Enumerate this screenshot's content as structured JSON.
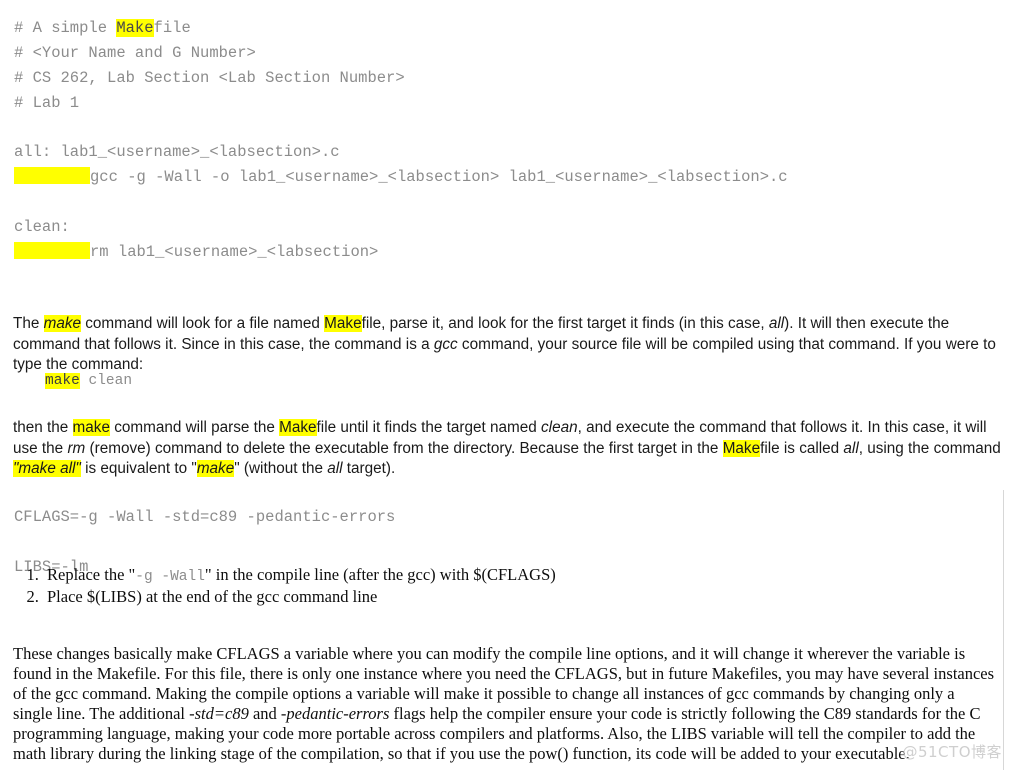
{
  "document": {
    "type": "makefile-tutorial-document",
    "background_color": "#ffffff",
    "highlight_color": "#ffff00",
    "code_color": "#8c8c8c",
    "body_text_color": "#1a1a1a"
  },
  "makefile_header": {
    "lines": [
      {
        "pre": "# A simple ",
        "highlight": "Make",
        "post": "file"
      },
      {
        "pre": "# <Your Name and G Number>",
        "highlight": "",
        "post": ""
      },
      {
        "pre": "# CS 262, Lab Section <Lab Section Number>",
        "highlight": "",
        "post": ""
      },
      {
        "pre": "# Lab 1",
        "highlight": "",
        "post": ""
      }
    ]
  },
  "makefile_rules": {
    "all_target": "all: lab1_<username>_<labsection>.c",
    "all_recipe": "gcc -g -Wall -o lab1_<username>_<labsection> lab1_<username>_<labsection>.c",
    "clean_target": "clean:",
    "clean_recipe": "rm lab1_<username>_<labsection>"
  },
  "paragraph_make": {
    "s1": "The ",
    "hl1": "make",
    "s2": " command will look for a file named ",
    "hl2": "Make",
    "s3": "file, parse it, and look for the first target it finds (in this case, ",
    "it1": "all",
    "s4": "). It will then execute the command that follows it. Since in this case, the command is a ",
    "it2": "gcc",
    "s5": " command, your source file will be compiled using that command.  If you were to type the command:"
  },
  "command_example": {
    "highlighted": "make",
    "rest": " clean"
  },
  "paragraph_clean": {
    "s1": "then the ",
    "hl1": "make",
    "s2": " command will parse the ",
    "hl2": "Make",
    "s3": "file until it finds the target named ",
    "it1": "clean",
    "s4": ", and execute the command that follows it. In this case, it will use the ",
    "it2": "rm",
    "s5": " (remove) command to delete the executable from the directory.  Because the first target in the ",
    "hl3": "Make",
    "s6": "file is called ",
    "it3": "all",
    "s7": ", using the command  ",
    "hl4": "\"make all\"",
    "s8": " is equivalent to \"",
    "hl5": "make",
    "s9": "\" (without the ",
    "it4": "all",
    "s10": " target)."
  },
  "flags_block": {
    "cflags": "CFLAGS=-g -Wall -std=c89 -pedantic-errors",
    "libs": "LIBS=-lm"
  },
  "steps": [
    {
      "pre": "Replace the \"",
      "code": "-g  -Wall",
      "post": "\" in the compile line (after the gcc) with $(CFLAGS)"
    },
    {
      "pre": "Place $(LIBS) at the end of the gcc command line",
      "code": "",
      "post": ""
    }
  ],
  "paragraph_summary": {
    "s1": "These changes basically make CFLAGS a variable where you can modify the compile line options, and it will change it wherever the variable is found in the Makefile.  For this file, there is only one instance where you need the CFLAGS, but in future Makefiles, you may have several instances of the gcc command.  Making the compile options a variable will make it possible to change all instances of gcc commands by changing only a single line. The additional ",
    "it1": "-std=c89",
    "s2": " and ",
    "it2": "-pedantic-errors",
    "s3": " flags help the compiler ensure your code is strictly following the C89 standards for the C programming language, making your code more portable across compilers and platforms.  Also, the LIBS variable will tell the compiler to add the math library during the linking stage of the compilation, so that if you use the pow() function, its code will be added to your executable."
  },
  "watermark": {
    "text": "@51CTO博客"
  }
}
